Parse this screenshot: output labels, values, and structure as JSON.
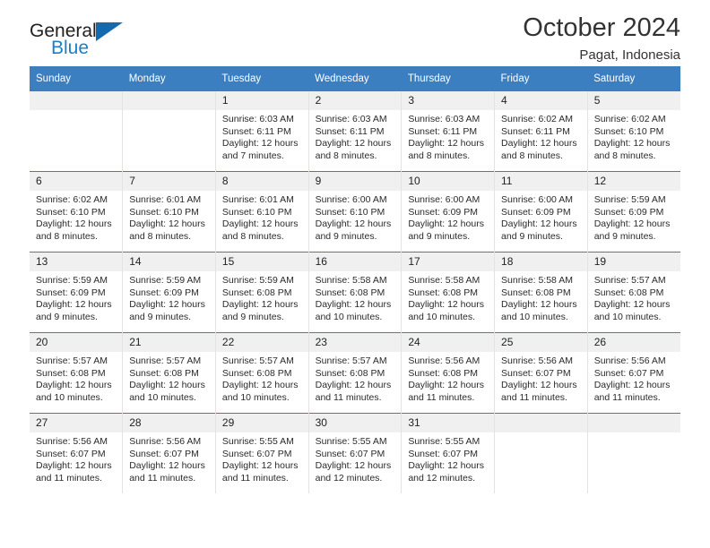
{
  "brand": {
    "line1": "General",
    "line2": "Blue",
    "triangle_icon": "blue-triangle-icon",
    "colors": {
      "general": "#231f20",
      "blue": "#1d7fc3",
      "triangle": "#1569ad"
    }
  },
  "header": {
    "title": "October 2024",
    "subtitle": "Pagat, Indonesia"
  },
  "colors": {
    "header_bar": "#3c7fc0",
    "daynum_bg": "#f0f0f0",
    "cell_border": "#e3e3e3",
    "text": "#222222"
  },
  "weekdays": [
    "Sunday",
    "Monday",
    "Tuesday",
    "Wednesday",
    "Thursday",
    "Friday",
    "Saturday"
  ],
  "weeks": [
    [
      {
        "day": "",
        "sunrise": "",
        "sunset": "",
        "daylight": ""
      },
      {
        "day": "",
        "sunrise": "",
        "sunset": "",
        "daylight": ""
      },
      {
        "day": "1",
        "sunrise": "Sunrise: 6:03 AM",
        "sunset": "Sunset: 6:11 PM",
        "daylight": "Daylight: 12 hours and 7 minutes."
      },
      {
        "day": "2",
        "sunrise": "Sunrise: 6:03 AM",
        "sunset": "Sunset: 6:11 PM",
        "daylight": "Daylight: 12 hours and 8 minutes."
      },
      {
        "day": "3",
        "sunrise": "Sunrise: 6:03 AM",
        "sunset": "Sunset: 6:11 PM",
        "daylight": "Daylight: 12 hours and 8 minutes."
      },
      {
        "day": "4",
        "sunrise": "Sunrise: 6:02 AM",
        "sunset": "Sunset: 6:11 PM",
        "daylight": "Daylight: 12 hours and 8 minutes."
      },
      {
        "day": "5",
        "sunrise": "Sunrise: 6:02 AM",
        "sunset": "Sunset: 6:10 PM",
        "daylight": "Daylight: 12 hours and 8 minutes."
      }
    ],
    [
      {
        "day": "6",
        "sunrise": "Sunrise: 6:02 AM",
        "sunset": "Sunset: 6:10 PM",
        "daylight": "Daylight: 12 hours and 8 minutes."
      },
      {
        "day": "7",
        "sunrise": "Sunrise: 6:01 AM",
        "sunset": "Sunset: 6:10 PM",
        "daylight": "Daylight: 12 hours and 8 minutes."
      },
      {
        "day": "8",
        "sunrise": "Sunrise: 6:01 AM",
        "sunset": "Sunset: 6:10 PM",
        "daylight": "Daylight: 12 hours and 8 minutes."
      },
      {
        "day": "9",
        "sunrise": "Sunrise: 6:00 AM",
        "sunset": "Sunset: 6:10 PM",
        "daylight": "Daylight: 12 hours and 9 minutes."
      },
      {
        "day": "10",
        "sunrise": "Sunrise: 6:00 AM",
        "sunset": "Sunset: 6:09 PM",
        "daylight": "Daylight: 12 hours and 9 minutes."
      },
      {
        "day": "11",
        "sunrise": "Sunrise: 6:00 AM",
        "sunset": "Sunset: 6:09 PM",
        "daylight": "Daylight: 12 hours and 9 minutes."
      },
      {
        "day": "12",
        "sunrise": "Sunrise: 5:59 AM",
        "sunset": "Sunset: 6:09 PM",
        "daylight": "Daylight: 12 hours and 9 minutes."
      }
    ],
    [
      {
        "day": "13",
        "sunrise": "Sunrise: 5:59 AM",
        "sunset": "Sunset: 6:09 PM",
        "daylight": "Daylight: 12 hours and 9 minutes."
      },
      {
        "day": "14",
        "sunrise": "Sunrise: 5:59 AM",
        "sunset": "Sunset: 6:09 PM",
        "daylight": "Daylight: 12 hours and 9 minutes."
      },
      {
        "day": "15",
        "sunrise": "Sunrise: 5:59 AM",
        "sunset": "Sunset: 6:08 PM",
        "daylight": "Daylight: 12 hours and 9 minutes."
      },
      {
        "day": "16",
        "sunrise": "Sunrise: 5:58 AM",
        "sunset": "Sunset: 6:08 PM",
        "daylight": "Daylight: 12 hours and 10 minutes."
      },
      {
        "day": "17",
        "sunrise": "Sunrise: 5:58 AM",
        "sunset": "Sunset: 6:08 PM",
        "daylight": "Daylight: 12 hours and 10 minutes."
      },
      {
        "day": "18",
        "sunrise": "Sunrise: 5:58 AM",
        "sunset": "Sunset: 6:08 PM",
        "daylight": "Daylight: 12 hours and 10 minutes."
      },
      {
        "day": "19",
        "sunrise": "Sunrise: 5:57 AM",
        "sunset": "Sunset: 6:08 PM",
        "daylight": "Daylight: 12 hours and 10 minutes."
      }
    ],
    [
      {
        "day": "20",
        "sunrise": "Sunrise: 5:57 AM",
        "sunset": "Sunset: 6:08 PM",
        "daylight": "Daylight: 12 hours and 10 minutes."
      },
      {
        "day": "21",
        "sunrise": "Sunrise: 5:57 AM",
        "sunset": "Sunset: 6:08 PM",
        "daylight": "Daylight: 12 hours and 10 minutes."
      },
      {
        "day": "22",
        "sunrise": "Sunrise: 5:57 AM",
        "sunset": "Sunset: 6:08 PM",
        "daylight": "Daylight: 12 hours and 10 minutes."
      },
      {
        "day": "23",
        "sunrise": "Sunrise: 5:57 AM",
        "sunset": "Sunset: 6:08 PM",
        "daylight": "Daylight: 12 hours and 11 minutes."
      },
      {
        "day": "24",
        "sunrise": "Sunrise: 5:56 AM",
        "sunset": "Sunset: 6:08 PM",
        "daylight": "Daylight: 12 hours and 11 minutes."
      },
      {
        "day": "25",
        "sunrise": "Sunrise: 5:56 AM",
        "sunset": "Sunset: 6:07 PM",
        "daylight": "Daylight: 12 hours and 11 minutes."
      },
      {
        "day": "26",
        "sunrise": "Sunrise: 5:56 AM",
        "sunset": "Sunset: 6:07 PM",
        "daylight": "Daylight: 12 hours and 11 minutes."
      }
    ],
    [
      {
        "day": "27",
        "sunrise": "Sunrise: 5:56 AM",
        "sunset": "Sunset: 6:07 PM",
        "daylight": "Daylight: 12 hours and 11 minutes."
      },
      {
        "day": "28",
        "sunrise": "Sunrise: 5:56 AM",
        "sunset": "Sunset: 6:07 PM",
        "daylight": "Daylight: 12 hours and 11 minutes."
      },
      {
        "day": "29",
        "sunrise": "Sunrise: 5:55 AM",
        "sunset": "Sunset: 6:07 PM",
        "daylight": "Daylight: 12 hours and 11 minutes."
      },
      {
        "day": "30",
        "sunrise": "Sunrise: 5:55 AM",
        "sunset": "Sunset: 6:07 PM",
        "daylight": "Daylight: 12 hours and 12 minutes."
      },
      {
        "day": "31",
        "sunrise": "Sunrise: 5:55 AM",
        "sunset": "Sunset: 6:07 PM",
        "daylight": "Daylight: 12 hours and 12 minutes."
      },
      {
        "day": "",
        "sunrise": "",
        "sunset": "",
        "daylight": ""
      },
      {
        "day": "",
        "sunrise": "",
        "sunset": "",
        "daylight": ""
      }
    ]
  ]
}
